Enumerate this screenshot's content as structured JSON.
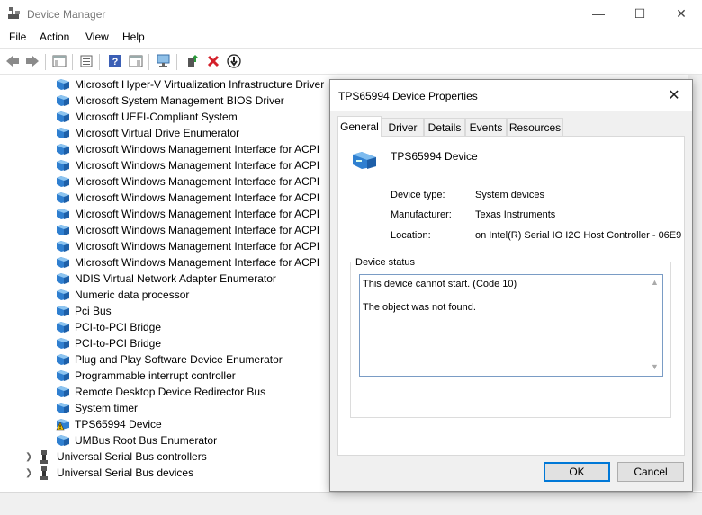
{
  "window": {
    "title": "Device Manager"
  },
  "menu": [
    "File",
    "Action",
    "View",
    "Help"
  ],
  "tree": {
    "items": [
      "Microsoft Hyper-V Virtualization Infrastructure Driver",
      "Microsoft System Management BIOS Driver",
      "Microsoft UEFI-Compliant System",
      "Microsoft Virtual Drive Enumerator",
      "Microsoft Windows Management Interface for ACPI",
      "Microsoft Windows Management Interface for ACPI",
      "Microsoft Windows Management Interface for ACPI",
      "Microsoft Windows Management Interface for ACPI",
      "Microsoft Windows Management Interface for ACPI",
      "Microsoft Windows Management Interface for ACPI",
      "Microsoft Windows Management Interface for ACPI",
      "Microsoft Windows Management Interface for ACPI",
      "NDIS Virtual Network Adapter Enumerator",
      "Numeric data processor",
      "Pci Bus",
      "PCI-to-PCI Bridge",
      "PCI-to-PCI Bridge",
      "Plug and Play Software Device Enumerator",
      "Programmable interrupt controller",
      "Remote Desktop Device Redirector Bus",
      "System timer",
      "TPS65994 Device",
      "UMBus Root Bus Enumerator"
    ],
    "categories": [
      "Universal Serial Bus controllers",
      "Universal Serial Bus devices"
    ]
  },
  "dialog": {
    "title": "TPS65994 Device Properties",
    "tabs": [
      "General",
      "Driver",
      "Details",
      "Events",
      "Resources"
    ],
    "device_name": "TPS65994 Device",
    "labels": {
      "type": "Device type:",
      "manufacturer": "Manufacturer:",
      "location": "Location:"
    },
    "values": {
      "type": "System devices",
      "manufacturer": "Texas Instruments",
      "location": "on Intel(R) Serial IO I2C Host Controller - 06E9"
    },
    "status_group": "Device status",
    "status_line1": "This device cannot start. (Code 10)",
    "status_line2": "The object was not found.",
    "ok_label": "OK",
    "cancel_label": "Cancel"
  },
  "colors": {
    "accent": "#0078d7",
    "warning": "#f2c200"
  }
}
